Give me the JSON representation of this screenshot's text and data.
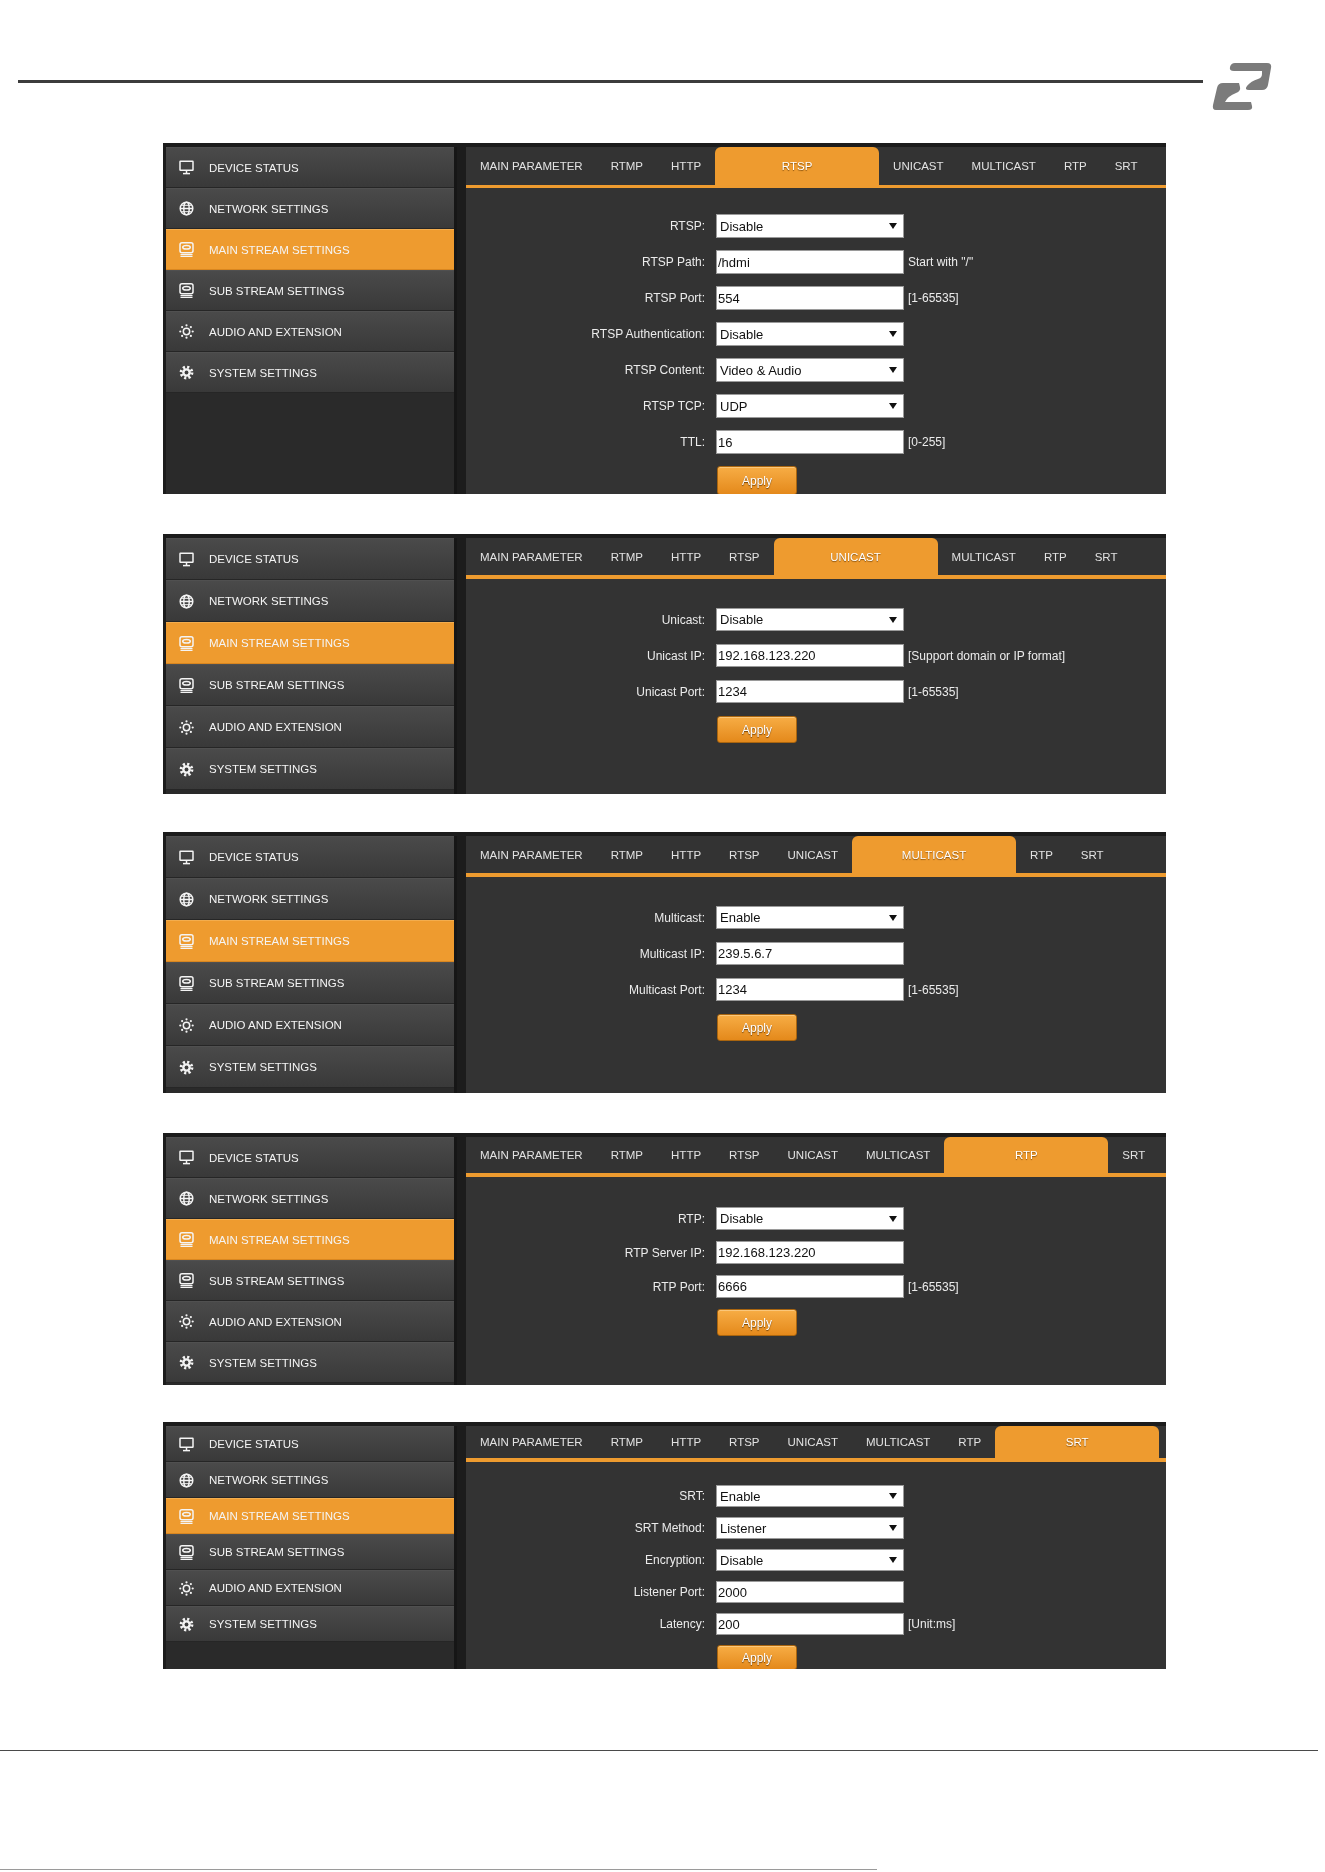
{
  "screenshots": [
    {
      "sidebar": {
        "items": [
          {
            "label": "DEVICE STATUS",
            "selected": false
          },
          {
            "label": "NETWORK SETTINGS",
            "selected": false
          },
          {
            "label": "MAIN STREAM SETTINGS",
            "selected": true
          },
          {
            "label": "SUB STREAM SETTINGS",
            "selected": false
          },
          {
            "label": "AUDIO AND EXTENSION",
            "selected": false
          },
          {
            "label": "SYSTEM SETTINGS",
            "selected": false
          }
        ]
      },
      "tabs": [
        {
          "label": "MAIN PARAMETER",
          "selected": false
        },
        {
          "label": "RTMP",
          "selected": false
        },
        {
          "label": "HTTP",
          "selected": false
        },
        {
          "label": "RTSP",
          "selected": true
        },
        {
          "label": "UNICAST",
          "selected": false
        },
        {
          "label": "MULTICAST",
          "selected": false
        },
        {
          "label": "RTP",
          "selected": false
        },
        {
          "label": "SRT",
          "selected": false
        }
      ],
      "form": {
        "fields": [
          {
            "kind": "select",
            "label": "RTSP:",
            "value": "Disable"
          },
          {
            "kind": "text",
            "label": "RTSP Path:",
            "value": "/hdmi",
            "hint": "Start with \"/\""
          },
          {
            "kind": "text",
            "label": "RTSP Port:",
            "value": "554",
            "hint": "[1-65535]"
          },
          {
            "kind": "select",
            "label": "RTSP Authentication:",
            "value": "Disable"
          },
          {
            "kind": "select",
            "label": "RTSP Content:",
            "value": "Video & Audio"
          },
          {
            "kind": "select",
            "label": "RTSP TCP:",
            "value": "UDP"
          },
          {
            "kind": "text",
            "label": "TTL:",
            "value": "16",
            "hint": "[0-255]"
          }
        ],
        "apply_button": "Apply"
      }
    },
    {
      "sidebar": {
        "items": [
          {
            "label": "DEVICE STATUS",
            "selected": false
          },
          {
            "label": "NETWORK SETTINGS",
            "selected": false
          },
          {
            "label": "MAIN STREAM SETTINGS",
            "selected": true
          },
          {
            "label": "SUB STREAM SETTINGS",
            "selected": false
          },
          {
            "label": "AUDIO AND EXTENSION",
            "selected": false
          },
          {
            "label": "SYSTEM SETTINGS",
            "selected": false
          }
        ]
      },
      "tabs": [
        {
          "label": "MAIN PARAMETER",
          "selected": false
        },
        {
          "label": "RTMP",
          "selected": false
        },
        {
          "label": "HTTP",
          "selected": false
        },
        {
          "label": "RTSP",
          "selected": false
        },
        {
          "label": "UNICAST",
          "selected": true
        },
        {
          "label": "MULTICAST",
          "selected": false
        },
        {
          "label": "RTP",
          "selected": false
        },
        {
          "label": "SRT",
          "selected": false
        }
      ],
      "form": {
        "fields": [
          {
            "kind": "select",
            "label": "Unicast:",
            "value": "Disable"
          },
          {
            "kind": "text",
            "label": "Unicast IP:",
            "value": "192.168.123.220",
            "hint": "[Support domain or IP format]"
          },
          {
            "kind": "text",
            "label": "Unicast Port:",
            "value": "1234",
            "hint": "[1-65535]"
          }
        ],
        "apply_button": "Apply"
      }
    },
    {
      "sidebar": {
        "items": [
          {
            "label": "DEVICE STATUS",
            "selected": false
          },
          {
            "label": "NETWORK SETTINGS",
            "selected": false
          },
          {
            "label": "MAIN STREAM SETTINGS",
            "selected": true
          },
          {
            "label": "SUB STREAM SETTINGS",
            "selected": false
          },
          {
            "label": "AUDIO AND EXTENSION",
            "selected": false
          },
          {
            "label": "SYSTEM SETTINGS",
            "selected": false
          }
        ]
      },
      "tabs": [
        {
          "label": "MAIN PARAMETER",
          "selected": false
        },
        {
          "label": "RTMP",
          "selected": false
        },
        {
          "label": "HTTP",
          "selected": false
        },
        {
          "label": "RTSP",
          "selected": false
        },
        {
          "label": "UNICAST",
          "selected": false
        },
        {
          "label": "MULTICAST",
          "selected": true
        },
        {
          "label": "RTP",
          "selected": false
        },
        {
          "label": "SRT",
          "selected": false
        }
      ],
      "form": {
        "fields": [
          {
            "kind": "select",
            "label": "Multicast:",
            "value": "Enable"
          },
          {
            "kind": "text",
            "label": "Multicast IP:",
            "value": "239.5.6.7"
          },
          {
            "kind": "text",
            "label": "Multicast Port:",
            "value": "1234",
            "hint": "[1-65535]"
          }
        ],
        "apply_button": "Apply"
      }
    },
    {
      "sidebar": {
        "items": [
          {
            "label": "DEVICE STATUS",
            "selected": false
          },
          {
            "label": "NETWORK SETTINGS",
            "selected": false
          },
          {
            "label": "MAIN STREAM SETTINGS",
            "selected": true
          },
          {
            "label": "SUB STREAM SETTINGS",
            "selected": false
          },
          {
            "label": "AUDIO AND EXTENSION",
            "selected": false
          },
          {
            "label": "SYSTEM SETTINGS",
            "selected": false
          }
        ]
      },
      "tabs": [
        {
          "label": "MAIN PARAMETER",
          "selected": false
        },
        {
          "label": "RTMP",
          "selected": false
        },
        {
          "label": "HTTP",
          "selected": false
        },
        {
          "label": "RTSP",
          "selected": false
        },
        {
          "label": "UNICAST",
          "selected": false
        },
        {
          "label": "MULTICAST",
          "selected": false
        },
        {
          "label": "RTP",
          "selected": true
        },
        {
          "label": "SRT",
          "selected": false
        }
      ],
      "form": {
        "fields": [
          {
            "kind": "select",
            "label": "RTP:",
            "value": "Disable"
          },
          {
            "kind": "text",
            "label": "RTP Server IP:",
            "value": "192.168.123.220"
          },
          {
            "kind": "text",
            "label": "RTP Port:",
            "value": "6666",
            "hint": "[1-65535]"
          }
        ],
        "apply_button": "Apply"
      }
    },
    {
      "sidebar": {
        "items": [
          {
            "label": "DEVICE STATUS",
            "selected": false
          },
          {
            "label": "NETWORK SETTINGS",
            "selected": false
          },
          {
            "label": "MAIN STREAM SETTINGS",
            "selected": true
          },
          {
            "label": "SUB STREAM SETTINGS",
            "selected": false
          },
          {
            "label": "AUDIO AND EXTENSION",
            "selected": false
          },
          {
            "label": "SYSTEM SETTINGS",
            "selected": false
          }
        ]
      },
      "tabs": [
        {
          "label": "MAIN PARAMETER",
          "selected": false
        },
        {
          "label": "RTMP",
          "selected": false
        },
        {
          "label": "HTTP",
          "selected": false
        },
        {
          "label": "RTSP",
          "selected": false
        },
        {
          "label": "UNICAST",
          "selected": false
        },
        {
          "label": "MULTICAST",
          "selected": false
        },
        {
          "label": "RTP",
          "selected": false
        },
        {
          "label": "SRT",
          "selected": true
        }
      ],
      "form": {
        "fields": [
          {
            "kind": "select",
            "label": "SRT:",
            "value": "Enable"
          },
          {
            "kind": "select",
            "label": "SRT Method:",
            "value": "Listener"
          },
          {
            "kind": "select",
            "label": "Encryption:",
            "value": "Disable"
          },
          {
            "kind": "text",
            "label": "Listener Port:",
            "value": "2000"
          },
          {
            "kind": "text",
            "label": "Latency:",
            "value": "200",
            "hint": "[Unit:ms]"
          }
        ],
        "apply_button": "Apply"
      }
    }
  ]
}
